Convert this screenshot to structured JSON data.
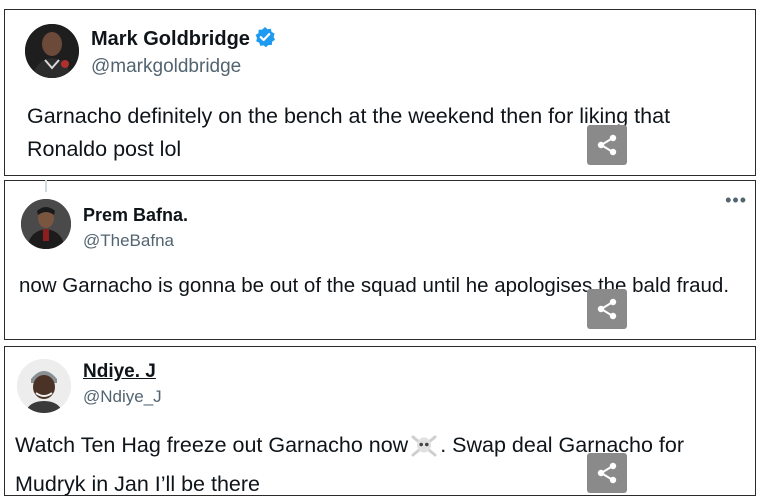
{
  "tweets": [
    {
      "name": "Mark Goldbridge",
      "handle": "@markgoldbridge",
      "verified": true,
      "text": "Garnacho definitely on the bench at the weekend then for liking that Ronaldo post lol"
    },
    {
      "name": "Prem Bafna.",
      "handle": "@TheBafna",
      "more_icon": "•••",
      "text": "now Garnacho is gonna be out of the squad until he apologises the bald fraud."
    },
    {
      "name": "Ndiye. J",
      "handle": "@Ndiye_J",
      "text_part1": "Watch Ten Hag freeze out Garnacho now",
      "emoji": "skull-and-crossbones",
      "text_part2": ". Swap deal Garnacho for Mudryk in Jan I’ll be there"
    }
  ],
  "colors": {
    "verified_blue": "#1d9bf0",
    "handle_gray": "#536471",
    "share_button_gray": "#8a8a8a"
  },
  "icons": [
    "verified-badge-icon",
    "more-options-icon",
    "share-icon"
  ]
}
